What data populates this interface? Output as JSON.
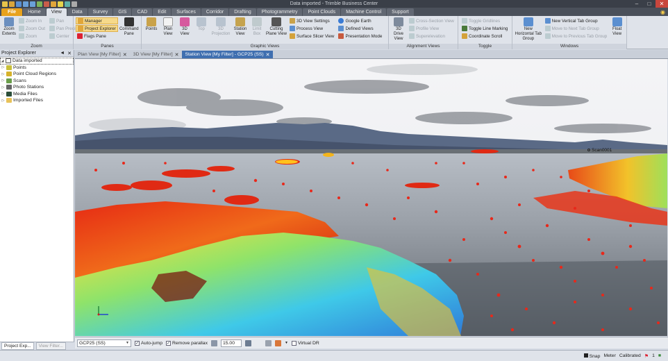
{
  "app": {
    "title": "Data imported - Trimble Business Center"
  },
  "ribbon_tabs": [
    "File",
    "Home",
    "View",
    "Data",
    "Survey",
    "GIS",
    "CAD",
    "Edit",
    "Surfaces",
    "Corridor",
    "Drafting",
    "Photogrammetry",
    "Point Clouds",
    "Machine Control",
    "Support"
  ],
  "active_tab": "View",
  "ribbon": {
    "zoom": {
      "label": "Zoom",
      "zoom_extents": "Zoom Extents",
      "zoom_in": "Zoom In",
      "zoom_out": "Zoom Out",
      "zoom": "Zoom",
      "pan": "Pan",
      "pan_precise": "Pan Precise",
      "center": "Center"
    },
    "panes": {
      "label": "Panes",
      "manager": "Manager",
      "project_explorer": "Project Explorer",
      "flags_pane": "Flags Pane",
      "command_pane": "Command Pane"
    },
    "graphic_views": {
      "label": "Graphic Views",
      "points": "Points",
      "plan_view": "Plan View",
      "3d_view": "3D View",
      "top": "Top",
      "3d_projection": "3D Projection",
      "station_view": "Station View",
      "limit_box": "Limit Box",
      "cutting_plane_view": "Cutting Plane View",
      "3d_view_settings": "3D View Settings",
      "process_view": "Process View",
      "surface_slicer_view": "Surface Slicer View",
      "google_earth": "Google Earth",
      "defined_views": "Defined Views",
      "presentation_mode": "Presentation Mode"
    },
    "alignment_views": {
      "label": "Alignment Views",
      "3d_drive_view": "3D Drive View",
      "cross_section_view": "Cross-Section View",
      "profile_view": "Profile View",
      "superelevation": "Superelevation"
    },
    "toggle": {
      "label": "Toggle",
      "toggle_gridlines": "Toggle Gridlines",
      "toggle_line_marking": "Toggle Line Marking",
      "coordinate_scroll": "Coordinate Scroll"
    },
    "windows": {
      "label": "Windows",
      "new_horizontal_tab_group": "New Horizontal Tab Group",
      "new_vertical_tab_group": "New Vertical Tab Group",
      "move_to_next_tab_group": "Move to Next Tab Group",
      "move_to_previous_tab_group": "Move to Previous Tab Group",
      "float_view": "Float View"
    }
  },
  "project_explorer": {
    "title": "Project Explorer",
    "root": "Data imported",
    "items": [
      "Points",
      "Point Cloud Regions",
      "Scans",
      "Photo Stations",
      "Media Files",
      "Imported Files"
    ],
    "footer_tabs": [
      "Project Exp...",
      "View Filter..."
    ]
  },
  "doc_tabs": [
    {
      "label": "Plan View [My Filter]",
      "active": false
    },
    {
      "label": "3D View [My Filter]",
      "active": false
    },
    {
      "label": "Station View [My Filter] - GCP25 (SS)",
      "active": true
    }
  ],
  "viewport": {
    "scan_label": "Scan0001"
  },
  "view_toolbar": {
    "station_select": "GCP25 (SS)",
    "auto_jump": "Auto-jump",
    "auto_jump_checked": true,
    "remove_parallax": "Remove parallax",
    "remove_parallax_checked": true,
    "value": "15.00",
    "virtual_dr": "Virtual DR",
    "virtual_dr_checked": false
  },
  "status_bar": {
    "snap": "Snap",
    "units": "Meter",
    "calibration": "Calibrated",
    "flag_count": "1"
  },
  "colors": {
    "file_tab": "#e8a21d",
    "active_doc_tab": "#3f6fb0",
    "title_bar": "#3a3f48"
  }
}
